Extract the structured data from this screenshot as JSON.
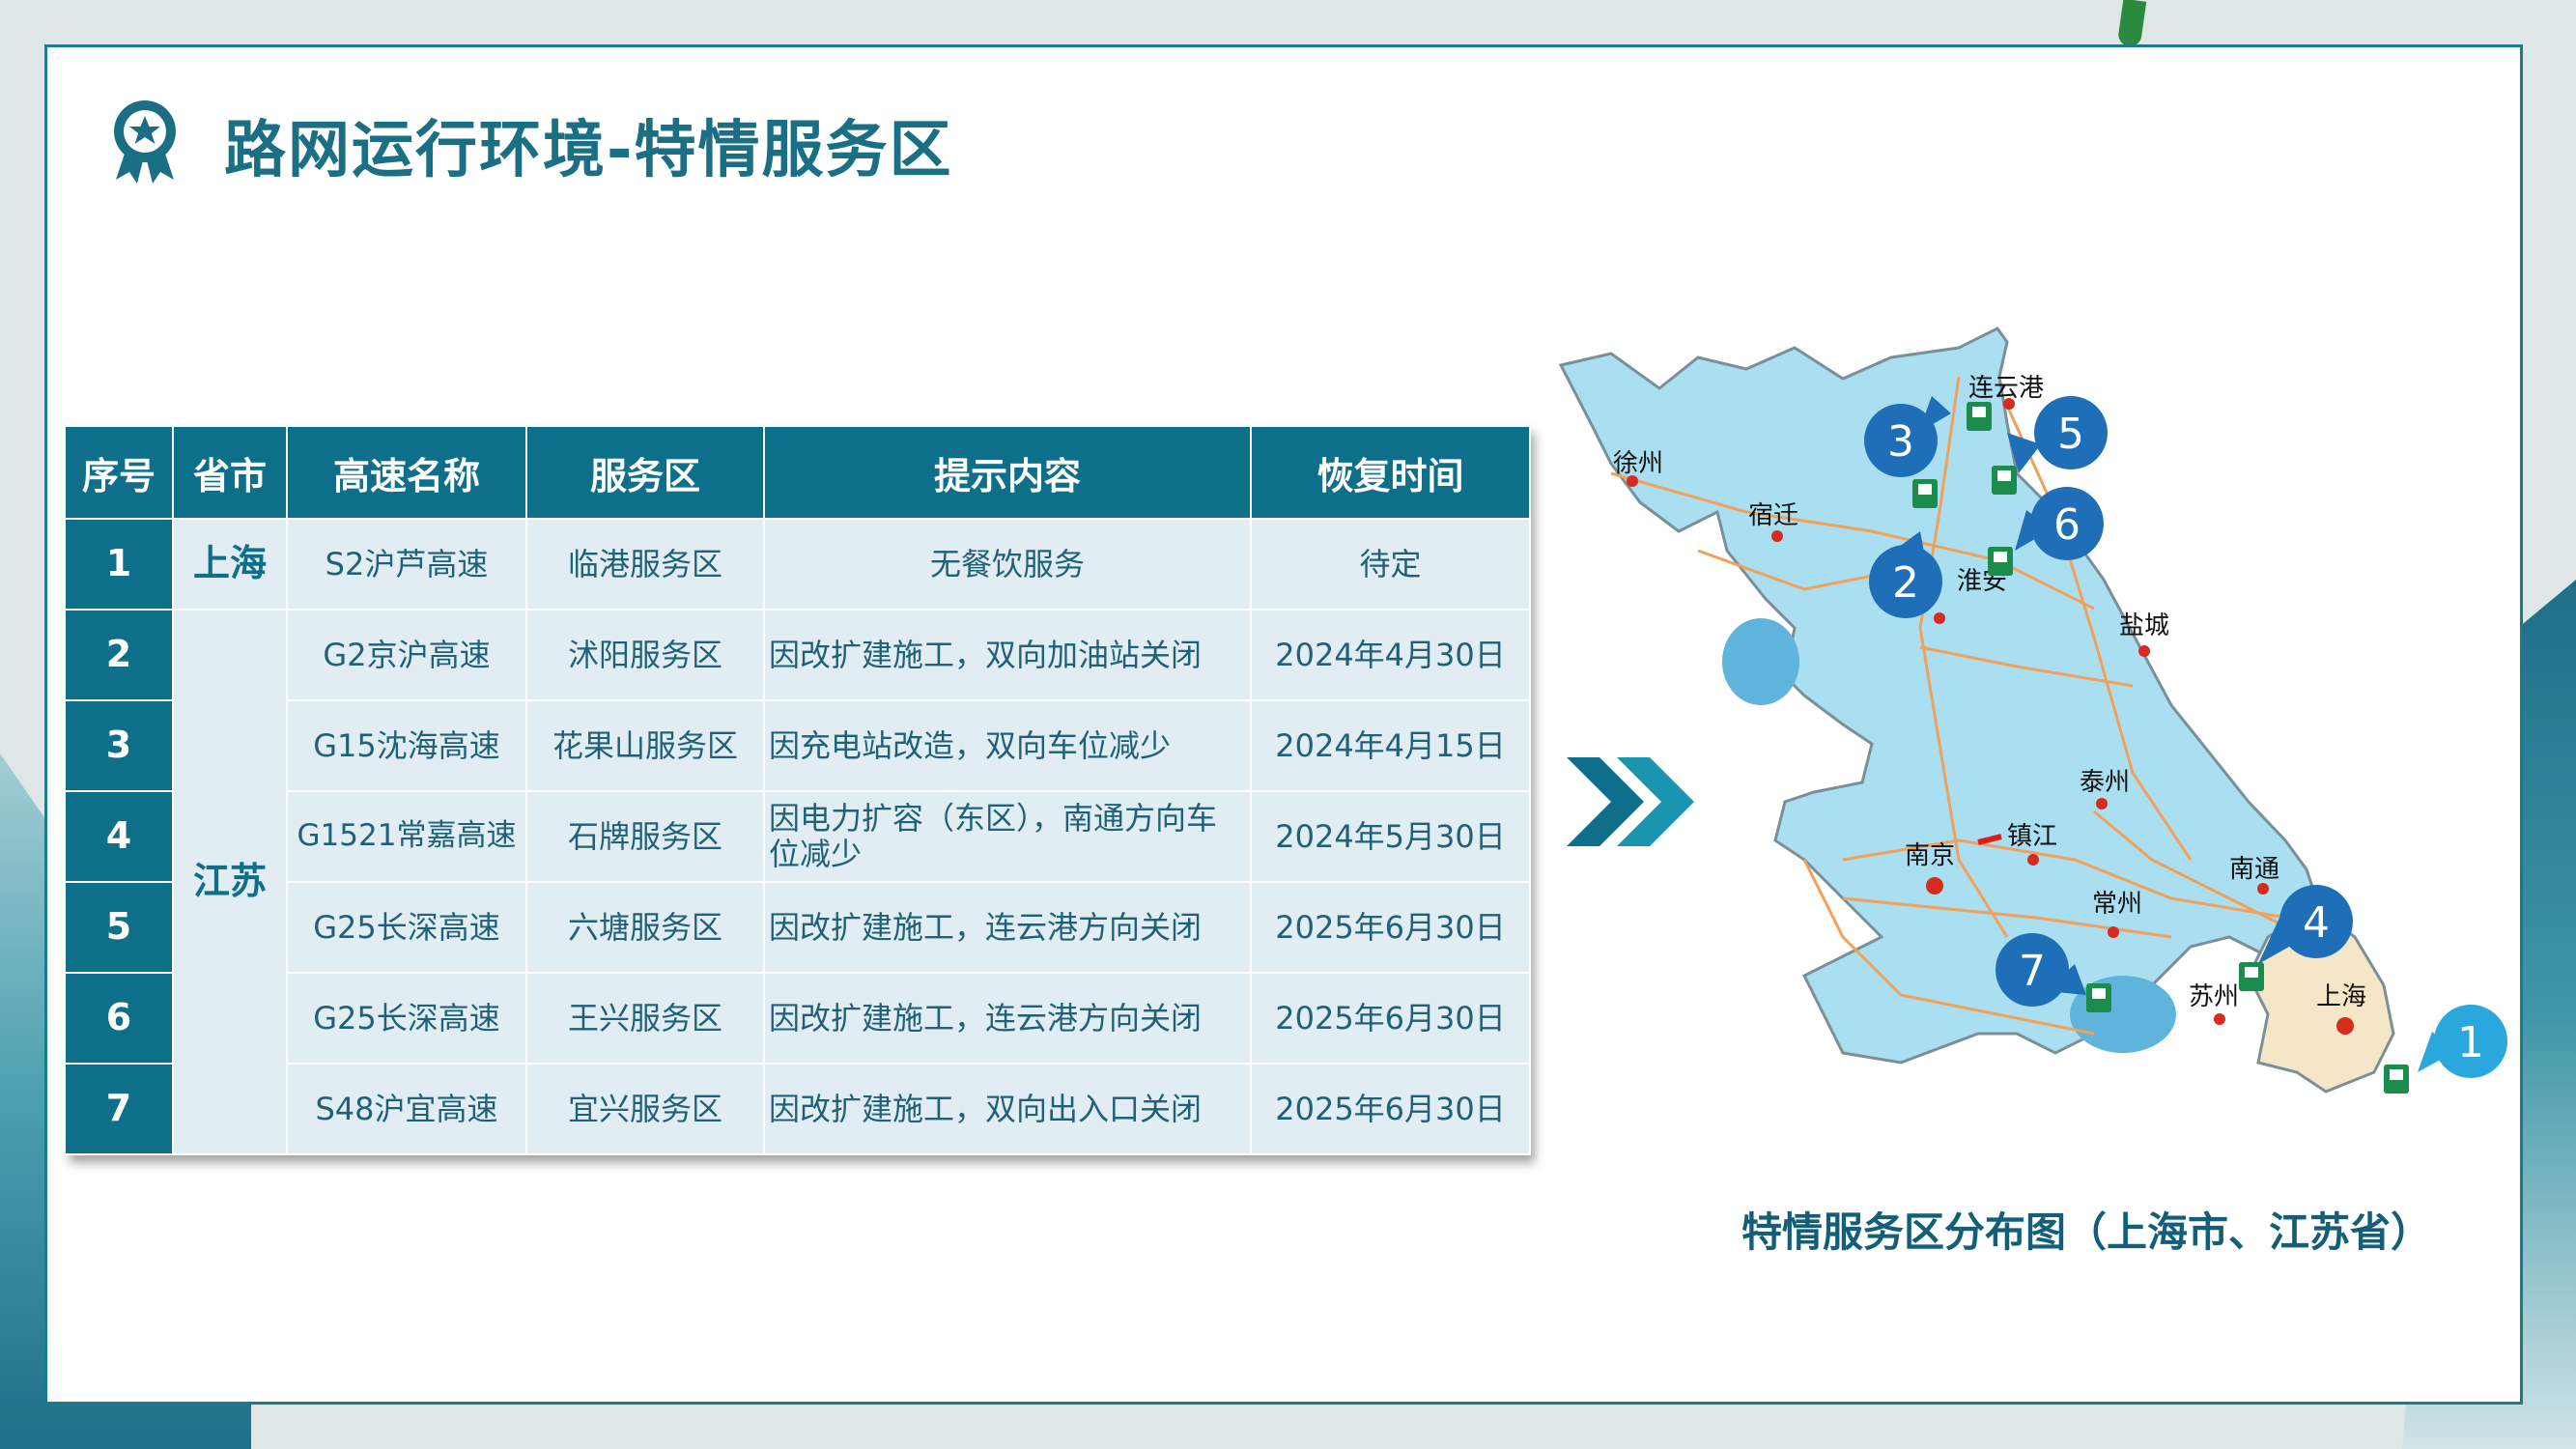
{
  "page": {
    "title": "路网运行环境-特情服务区"
  },
  "table": {
    "headers": [
      "序号",
      "省市",
      "高速名称",
      "服务区",
      "提示内容",
      "恢复时间"
    ],
    "rows": [
      {
        "no": "1",
        "province": "上海",
        "highway": "S2沪芦高速",
        "area": "临港服务区",
        "tip": "无餐饮服务",
        "recovery": "待定"
      },
      {
        "no": "2",
        "province": "江苏",
        "highway": "G2京沪高速",
        "area": "沭阳服务区",
        "tip": "因改扩建施工，双向加油站关闭",
        "recovery": "2024年4月30日"
      },
      {
        "no": "3",
        "province": "江苏",
        "highway": "G15沈海高速",
        "area": "花果山服务区",
        "tip": "因充电站改造，双向车位减少",
        "recovery": "2024年4月15日"
      },
      {
        "no": "4",
        "province": "江苏",
        "highway": "G1521常嘉高速",
        "area": "石牌服务区",
        "tip": "因电力扩容（东区），南通方向车位减少",
        "recovery": "2024年5月30日"
      },
      {
        "no": "5",
        "province": "江苏",
        "highway": "G25长深高速",
        "area": "六塘服务区",
        "tip": "因改扩建施工，连云港方向关闭",
        "recovery": "2025年6月30日"
      },
      {
        "no": "6",
        "province": "江苏",
        "highway": "G25长深高速",
        "area": "王兴服务区",
        "tip": "因改扩建施工，连云港方向关闭",
        "recovery": "2025年6月30日"
      },
      {
        "no": "7",
        "province": "江苏",
        "highway": "S48沪宜高速",
        "area": "宜兴服务区",
        "tip": "因改扩建施工，双向出入口关闭",
        "recovery": "2025年6月30日"
      }
    ]
  },
  "map": {
    "caption": "特情服务区分布图（上海市、江苏省）",
    "cities": [
      "徐州",
      "连云港",
      "宿迁",
      "淮安",
      "盐城",
      "泰州",
      "镇江",
      "南京",
      "常州",
      "南通",
      "苏州",
      "上海"
    ],
    "pins": [
      "1",
      "2",
      "3",
      "4",
      "5",
      "6",
      "7"
    ]
  },
  "colors": {
    "primary": "#0e6f8b",
    "title": "#1a6f84",
    "cell_bg": "#e2ecf3",
    "map_fill": "#a9dff0",
    "pin": "#1f6fb8"
  },
  "icons": [
    "award-badge-icon",
    "double-chevron-right-icon",
    "fuel-station-icon"
  ]
}
